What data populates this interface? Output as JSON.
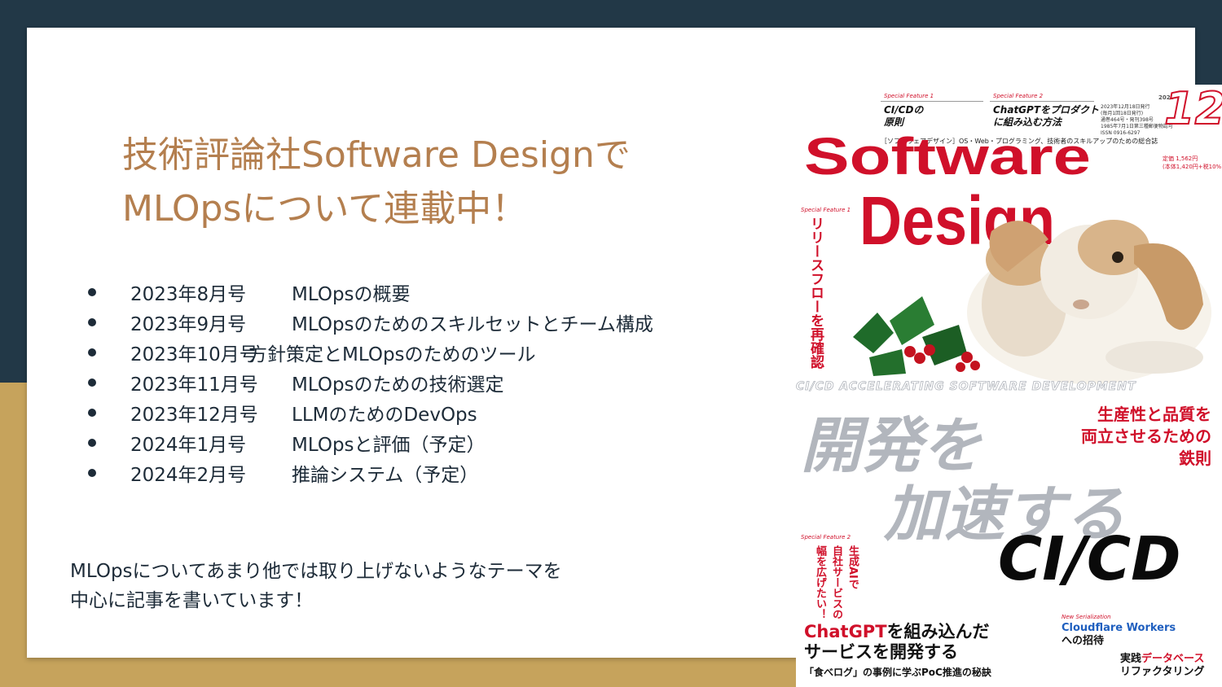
{
  "slide": {
    "title_lines": [
      "技術評論社Software Designで",
      "MLOpsについて連載中！"
    ],
    "issues": [
      {
        "date": "2023年8月号",
        "topic": "MLOpsの概要"
      },
      {
        "date": "2023年9月号",
        "topic": "MLOpsのためのスキルセットとチーム構成"
      },
      {
        "date": "2023年10月号",
        "topic": "方針策定とMLOpsのためのツール"
      },
      {
        "date": "2023年11月号",
        "topic": "MLOpsのための技術選定"
      },
      {
        "date": "2023年12月号",
        "topic": "LLMのためのDevOps"
      },
      {
        "date": "2024年1月号",
        "topic": "MLOpsと評価（予定）"
      },
      {
        "date": "2024年2月号",
        "topic": "推論システム（予定）"
      }
    ],
    "note_lines": [
      "MLOpsについてあまり他では取り上げないようなテーマを",
      "中心に記事を書いています！"
    ],
    "colors": {
      "background": "#223847",
      "accent_band": "#c6a35c",
      "title": "#b47f4f",
      "text": "#1d2b38"
    }
  },
  "cover": {
    "feature1_label": "Special Feature 1",
    "feature1_title": [
      "CI/CDの",
      "原則"
    ],
    "feature2_label": "Special Feature 2",
    "feature2_title": [
      "ChatGPTをプロダクト",
      "に組み込む方法"
    ],
    "publication_info": [
      "2023年12月18日発行",
      "(毎月1回18日発行)",
      "通巻464号・発刊398号",
      "1985年7月1日第三種郵便物認可",
      "ISSN 0916-6297"
    ],
    "year": "2023",
    "issue_number": "12",
    "tagline": "［ソフトウェアデザイン］OS・Web・プログラミング、技術者のスキルアップのための総合誌",
    "logo_line1": "Software",
    "logo_line2": "Design",
    "price": [
      "定価 1,562円",
      "(本体1,420円+税10%)"
    ],
    "vertical1_label": "Special Feature 1",
    "vertical1": "リリースフローを再確認",
    "banner": "CI/CD ACCELERATING SOFTWARE DEVELOPMENT",
    "headline1": "開発を",
    "headline2": "加速する",
    "headline3": "CI/CD",
    "side_copy": [
      "生産性と品質を",
      "両立させるための",
      "鉄則"
    ],
    "vertical2_label": "Special Feature 2",
    "vertical2_a": "生成AIで",
    "vertical2_b": "自社サービスの",
    "vertical2_c": "幅を広げたい！",
    "gpt_red": "ChatGPT",
    "gpt_rest": "を組み込んだ",
    "gpt_line2": "サービスを開発する",
    "gpt_sub": "「食べログ」の事例に学ぶPoC推進の秘訣",
    "serial_label": "New Serialization",
    "serial_title": "Cloudflare Workers",
    "serial_sub": "への招待",
    "db_black": "実践",
    "db_red": "データベース",
    "db_line2": "リファクタリング",
    "image_subject": "rabbit-with-holly"
  }
}
